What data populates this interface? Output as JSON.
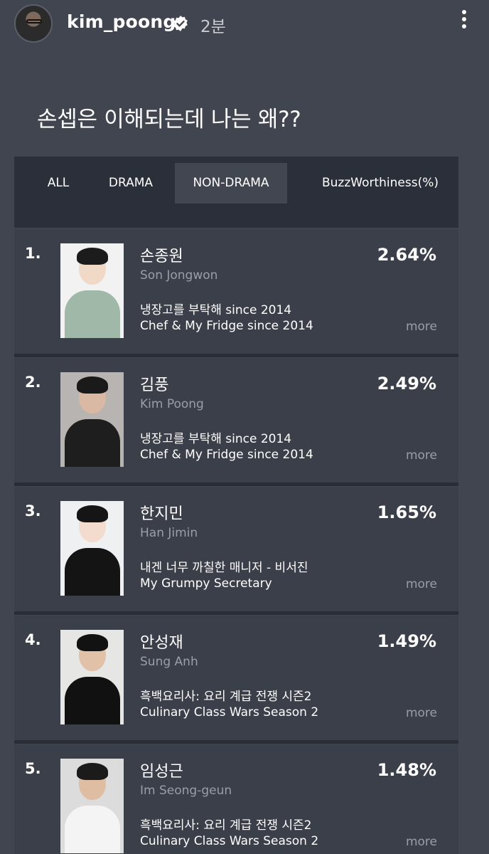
{
  "header": {
    "username": "kim_poong",
    "time": "2분"
  },
  "caption": "손셉은 이해되는데 나는 왜??",
  "tabs": [
    "ALL",
    "DRAMA",
    "NON-DRAMA",
    "BuzzWorthiness(%)"
  ],
  "active_tab": "NON-DRAMA",
  "more_label": "more",
  "rankings": [
    {
      "rank": "1.",
      "name_ko": "손종원",
      "name_en": "Son Jongwon",
      "work_ko": "냉장고를 부탁해 since 2014",
      "work_en": "Chef & My Fridge since 2014",
      "percent": "2.64%"
    },
    {
      "rank": "2.",
      "name_ko": "김풍",
      "name_en": "Kim Poong",
      "work_ko": "냉장고를 부탁해 since 2014",
      "work_en": "Chef & My Fridge since 2014",
      "percent": "2.49%"
    },
    {
      "rank": "3.",
      "name_ko": "한지민",
      "name_en": "Han Jimin",
      "work_ko": "내겐 너무 까칠한 매니저 - 비서진",
      "work_en": "My Grumpy Secretary",
      "percent": "1.65%"
    },
    {
      "rank": "4.",
      "name_ko": "안성재",
      "name_en": "Sung Anh",
      "work_ko": "흑백요리사: 요리 계급 전쟁 시즌2",
      "work_en": "Culinary Class Wars Season 2",
      "percent": "1.49%"
    },
    {
      "rank": "5.",
      "name_ko": "임성근",
      "name_en": "Im Seong-geun",
      "work_ko": "흑백요리사: 요리 계급 전쟁 시즌2",
      "work_en": "Culinary Class Wars Season 2",
      "percent": "1.48%"
    }
  ]
}
